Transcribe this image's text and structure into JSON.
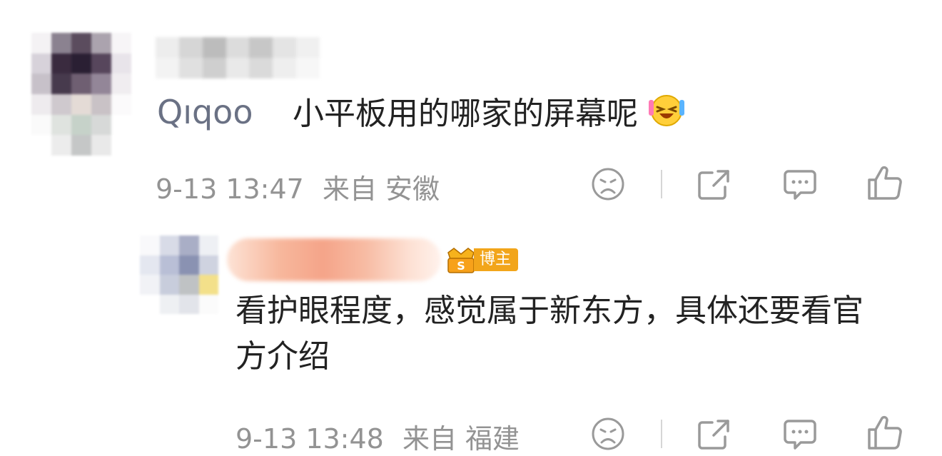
{
  "comments": [
    {
      "name_redacted": true,
      "prefix_tag": "Qıqoo",
      "text": "小平板用的哪家的屏幕呢",
      "emoji": "laugh-cry-emoji",
      "time": "9-13 13:47",
      "location": "来自 安徽"
    },
    {
      "name_redacted": true,
      "badge": "博主",
      "text": "看护眼程度，感觉属于新东方，具体还要看官方介绍",
      "time": "9-13 13:48",
      "location": "来自 福建"
    }
  ],
  "actions": [
    "dislike-icon",
    "share-icon",
    "reply-icon",
    "like-icon"
  ],
  "colors": {
    "meta": "#939393",
    "icon": "#9a9a9a",
    "badge": "#f2a51a",
    "text": "#222222"
  }
}
